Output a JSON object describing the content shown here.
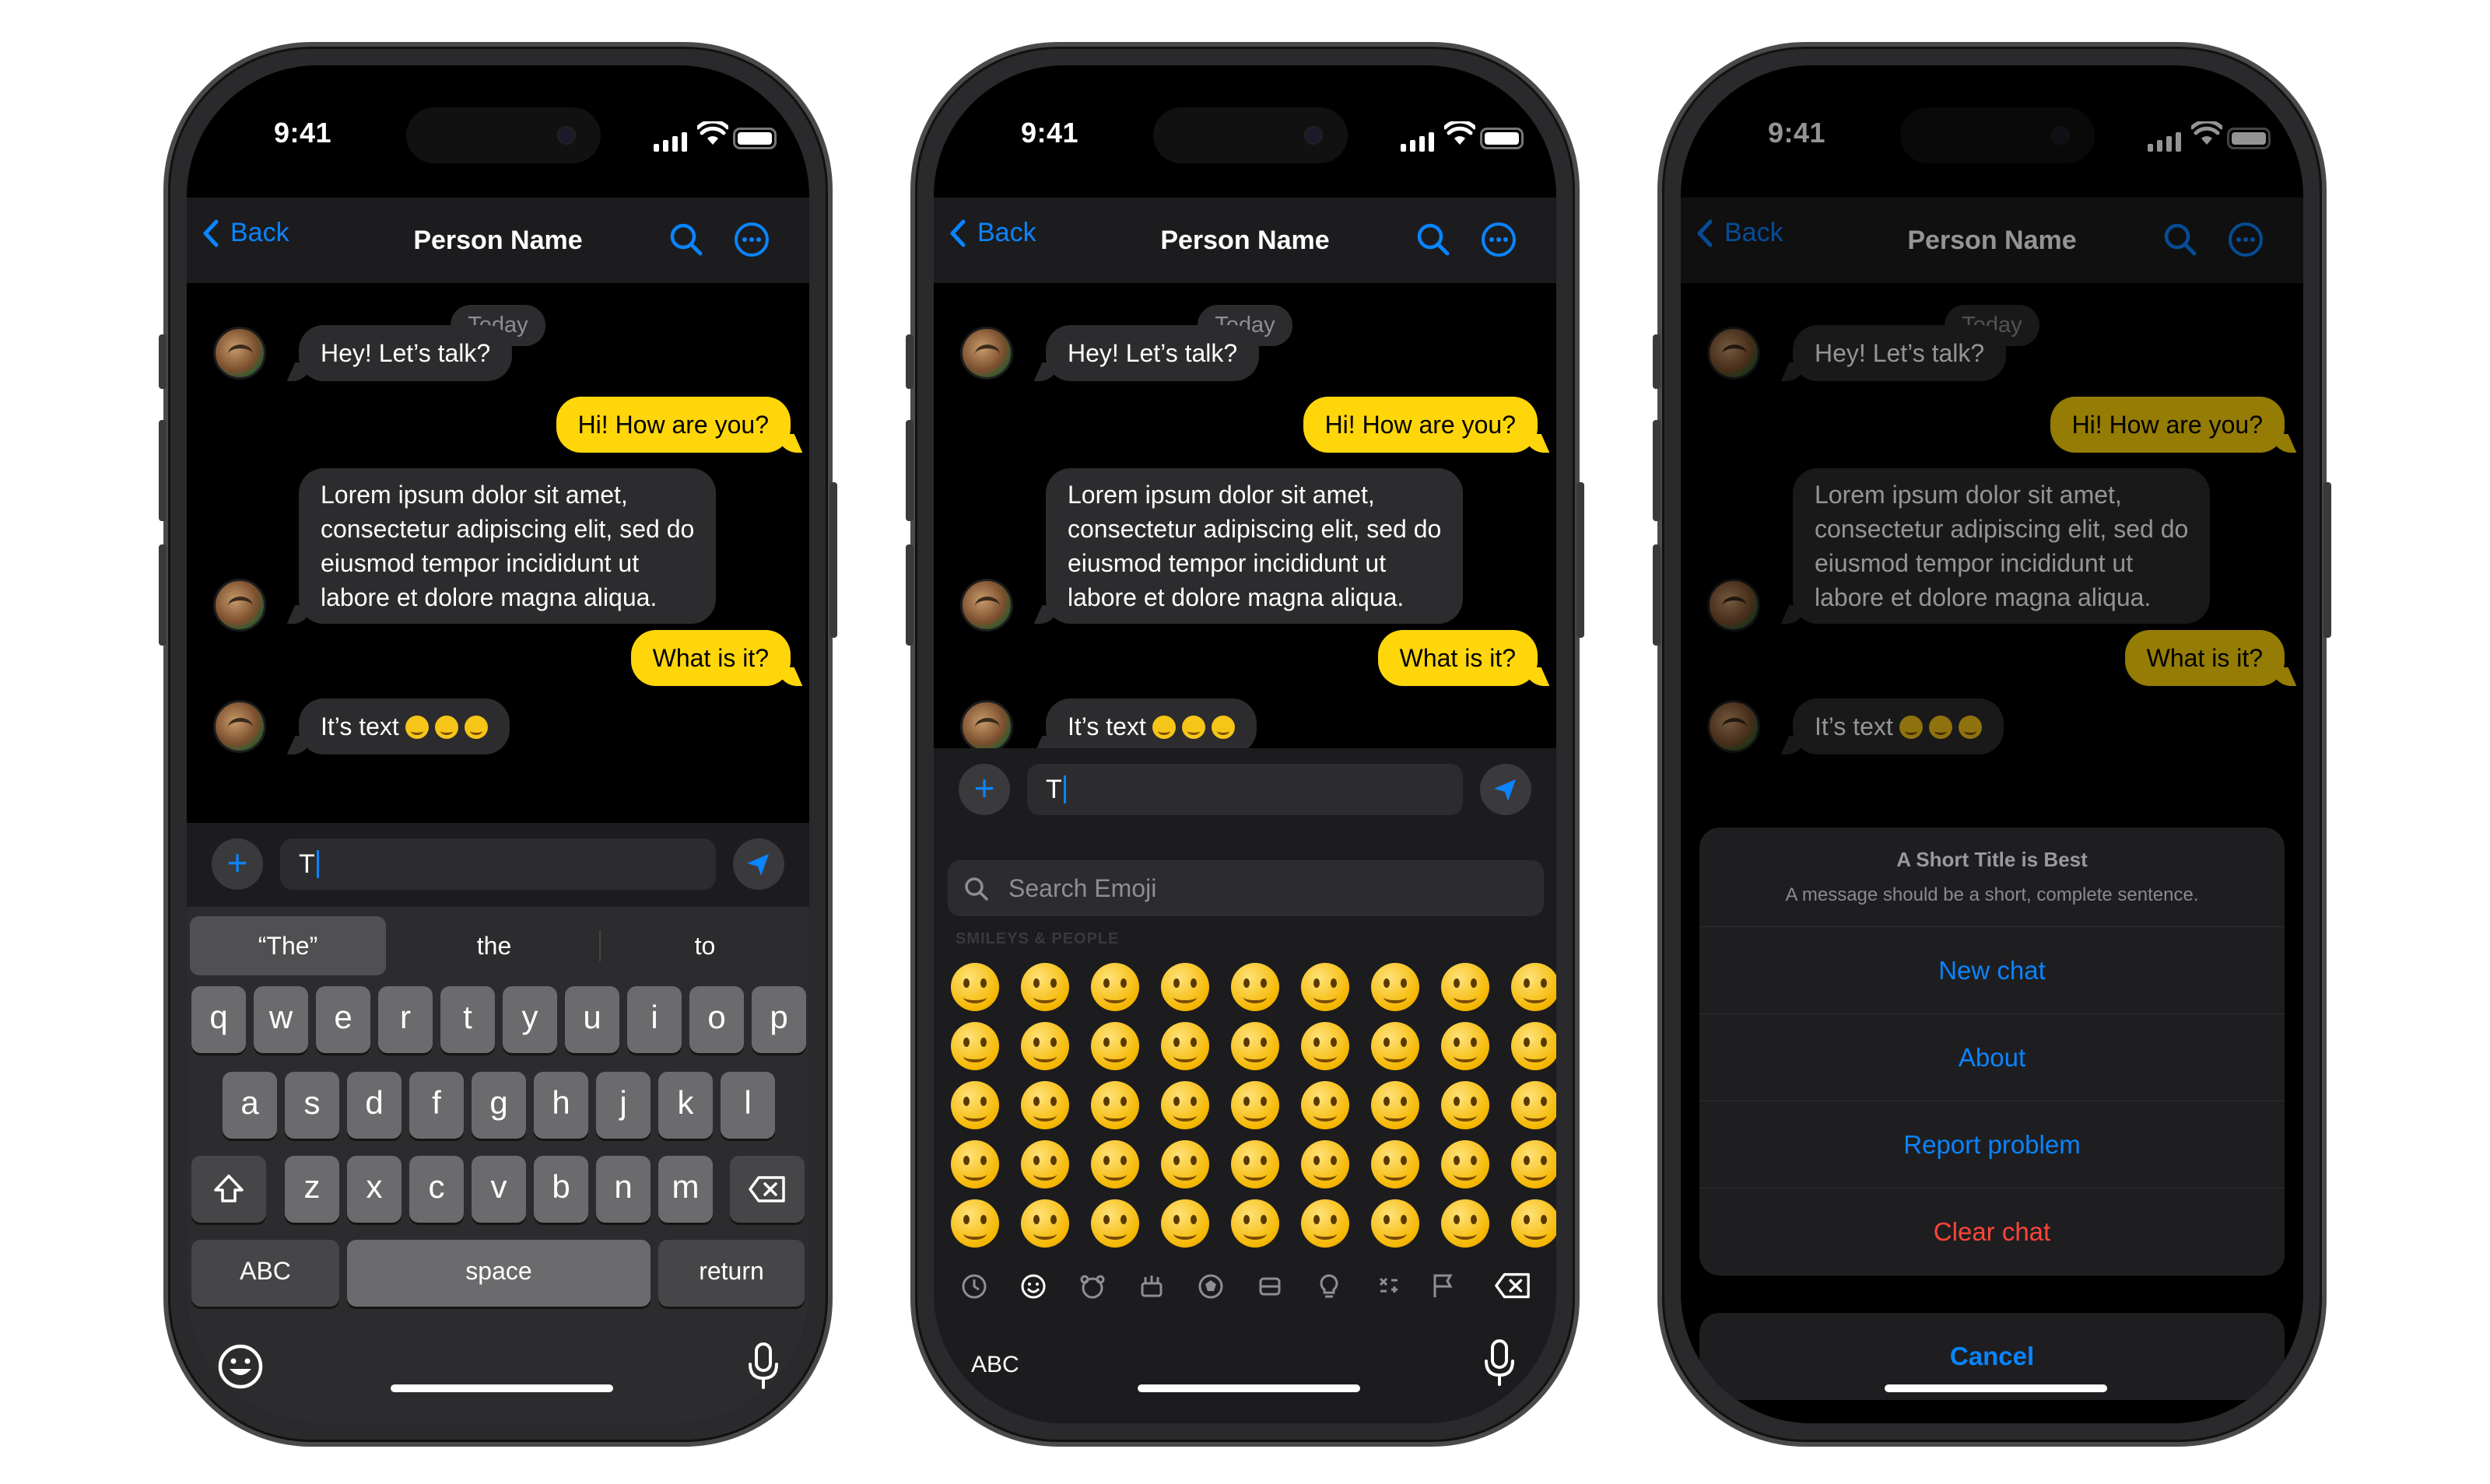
{
  "status": {
    "time": "9:41"
  },
  "nav": {
    "back_label": "Back",
    "title": "Person Name"
  },
  "chat": {
    "date_label": "Today",
    "messages": [
      {
        "text": "Hey! Let’s talk?"
      },
      {
        "text": "Hi! How are you?"
      },
      {
        "line1": "Lorem ipsum dolor sit amet,",
        "line2": "consectetur adipiscing elit, sed do",
        "line3": "eiusmod tempor incididunt ut",
        "line4": "labore et dolore magna aliqua."
      },
      {
        "text": "What is it?"
      },
      {
        "text": "It’s text"
      }
    ]
  },
  "composer": {
    "typed_text": "T"
  },
  "keyboard": {
    "suggestions": [
      "“The”",
      "the",
      "to"
    ],
    "row1": [
      "q",
      "w",
      "e",
      "r",
      "t",
      "y",
      "u",
      "i",
      "o",
      "p"
    ],
    "row2": [
      "a",
      "s",
      "d",
      "f",
      "g",
      "h",
      "j",
      "k",
      "l"
    ],
    "row3": [
      "z",
      "x",
      "c",
      "v",
      "b",
      "n",
      "m"
    ],
    "abc": "ABC",
    "space": "space",
    "return": "return"
  },
  "emoji_keyboard": {
    "search_placeholder": "Search Emoji",
    "category_label": "SMILEYS & PEOPLE",
    "abc": "ABC"
  },
  "action_sheet": {
    "title": "A Short Title is Best",
    "message": "A message should be a short, complete sentence.",
    "actions": [
      "New chat",
      "About",
      "Report problem",
      "Clear chat"
    ],
    "cancel": "Cancel"
  },
  "colors": {
    "accent": "#0a84ff",
    "outgoing": "#ffd60a",
    "destructive": "#ff453a"
  }
}
